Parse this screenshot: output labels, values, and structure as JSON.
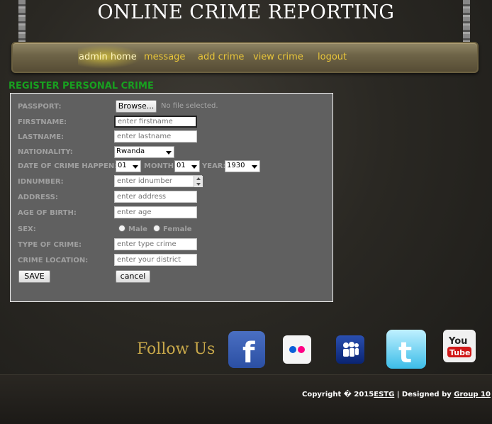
{
  "header": {
    "title": "ONLINE CRIME REPORTING"
  },
  "nav": {
    "items": [
      "admin home",
      "message",
      "add crime",
      "view crime",
      "logout"
    ],
    "active": "admin home",
    "item_color": "#e8c53a"
  },
  "form": {
    "title": "REGISTER PERSONAL CRIME",
    "passport": {
      "label": "PASSPORT:",
      "button": "Browse...",
      "status": "No file selected."
    },
    "firstname": {
      "label": "FIRSTNAME:",
      "placeholder": "enter firstname"
    },
    "lastname": {
      "label": "LASTNAME:",
      "placeholder": "enter lastname"
    },
    "nationality": {
      "label": "NATIONALITY:",
      "value": "Rwanda"
    },
    "date": {
      "label": "DATE OF CRIME HAPPEN:",
      "day": "01",
      "month_label": "MONTH:",
      "month": "01",
      "year_label": "YEAR:",
      "year": "1930"
    },
    "idnumber": {
      "label": "IDNUMBER:",
      "placeholder": "enter idnumber"
    },
    "address": {
      "label": "ADDRESS:",
      "placeholder": "enter address"
    },
    "age": {
      "label": "AGE OF BIRTH:",
      "placeholder": "enter age"
    },
    "sex": {
      "label": "SEX:",
      "options": [
        "Male",
        "Female"
      ]
    },
    "type": {
      "label": "TYPE OF CRIME:",
      "placeholder": "enter type crime"
    },
    "location": {
      "label": "CRIME LOCATION:",
      "placeholder": "enter your district"
    },
    "save_label": "SAVE",
    "cancel_label": "cancel"
  },
  "follow": {
    "label": "Follow Us",
    "icons": [
      "facebook-icon",
      "flickr-icon",
      "myspace-icon",
      "twitter-icon",
      "youtube-icon"
    ]
  },
  "footer": {
    "copyright_prefix": "Copyright � 2015",
    "org_link": "ESTG",
    "designed_by": " | Designed by ",
    "group_link": "Group 10"
  },
  "colors": {
    "section_title": "#18a020",
    "panel_bg": "#606060",
    "follow_text": "#c8a84a"
  }
}
